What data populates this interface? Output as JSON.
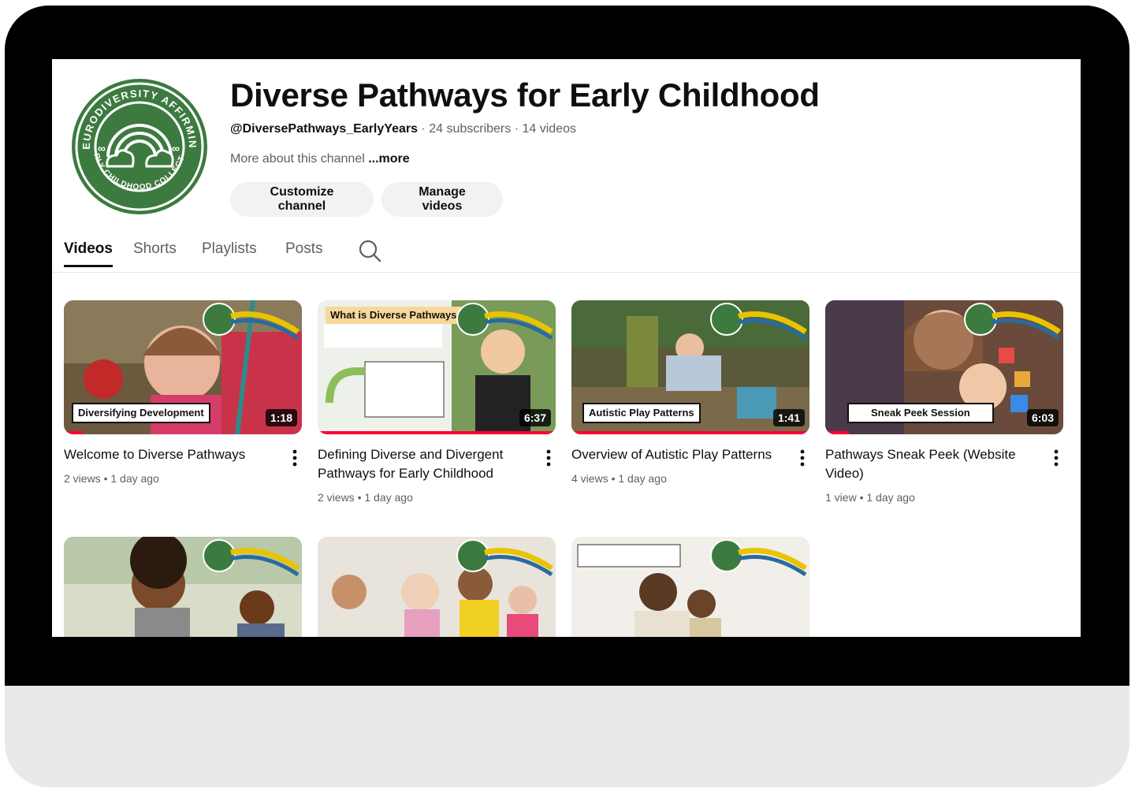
{
  "channel": {
    "name": "Diverse Pathways for Early Childhood",
    "handle": "@DiversePathways_EarlyYears",
    "subscribers": "24 subscribers",
    "videos_count": "14 videos",
    "separator": " · ",
    "about_text": "More about this channel ",
    "about_more": "...more",
    "logo_top_text": "NEURODIVERSITY AFFIRMING",
    "logo_bottom_text": "EARLY CHILDHOOD COLLECTIVE",
    "brand_color": "#3c7a3f"
  },
  "buttons": {
    "customize": "Customize channel",
    "manage": "Manage videos"
  },
  "tabs": [
    {
      "label": "Videos",
      "active": true
    },
    {
      "label": "Shorts",
      "active": false
    },
    {
      "label": "Playlists",
      "active": false
    },
    {
      "label": "Posts",
      "active": false
    }
  ],
  "videos": [
    {
      "title": "Welcome to Diverse Pathways",
      "views": "2 views",
      "age": "1 day ago",
      "duration": "1:18",
      "banner": "Diversifying Development",
      "progress": 0.08
    },
    {
      "title": "Defining Diverse and Divergent Pathways for Early Childhood",
      "views": "2 views",
      "age": "1 day ago",
      "duration": "6:37",
      "banner": "What is Diverse Pathways",
      "progress": 1.0
    },
    {
      "title": "Overview of Autistic Play Patterns",
      "views": "4 views",
      "age": "1 day ago",
      "duration": "1:41",
      "banner": "Autistic Play Patterns",
      "progress": 1.0
    },
    {
      "title": "Pathways Sneak Peek (Website Video)",
      "views": "1 view",
      "age": "1 day ago",
      "duration": "6:03",
      "banner": "Sneak Peek Session",
      "progress": 0.1
    },
    {
      "title": "",
      "views": "",
      "age": "",
      "duration": "",
      "banner": "",
      "progress": 0
    },
    {
      "title": "",
      "views": "",
      "age": "",
      "duration": "",
      "banner": "",
      "progress": 0
    },
    {
      "title": "",
      "views": "",
      "age": "",
      "duration": "",
      "banner": "",
      "progress": 0
    }
  ],
  "colors": {
    "accent_red": "#ff0033",
    "text_primary": "#0f0f0f",
    "text_secondary": "#606060",
    "bezel": "#000000"
  },
  "icons": [
    "search-icon",
    "more-vert-icon",
    "rainbow-cloud-logo-icon"
  ]
}
